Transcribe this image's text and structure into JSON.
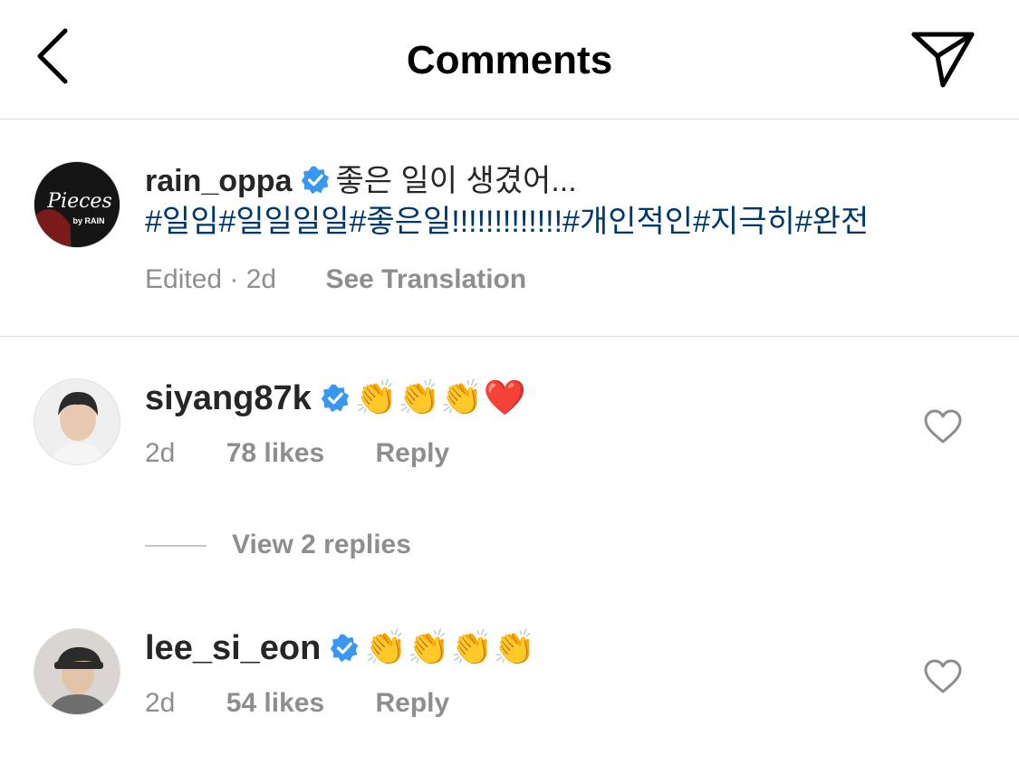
{
  "header": {
    "title": "Comments",
    "back_icon": "chevron-left-icon",
    "send_icon": "paper-plane-icon"
  },
  "caption": {
    "username": "rain_oppa",
    "text": "좋은 일이 생겼어...",
    "hashtags": "#일임#일일일일#좋은일!!!!!!!!!!!!!#개인적인#지극히#완전",
    "edited": "Edited · 2d",
    "see_translation": "See Translation",
    "avatar_logo_text": "Pieces by RAIN"
  },
  "comments": [
    {
      "username": "siyang87k",
      "text": "👏👏👏❤️",
      "time": "2d",
      "likes": "78 likes",
      "reply": "Reply"
    },
    {
      "username": "lee_si_eon",
      "text": "👏👏👏👏",
      "time": "2d",
      "likes": "54 likes",
      "reply": "Reply"
    }
  ],
  "view_replies": "View 2 replies",
  "colors": {
    "hashtag": "#00376b",
    "verified": "#3897f0",
    "meta": "#8e8e8e",
    "divider": "#dbdbdb"
  }
}
